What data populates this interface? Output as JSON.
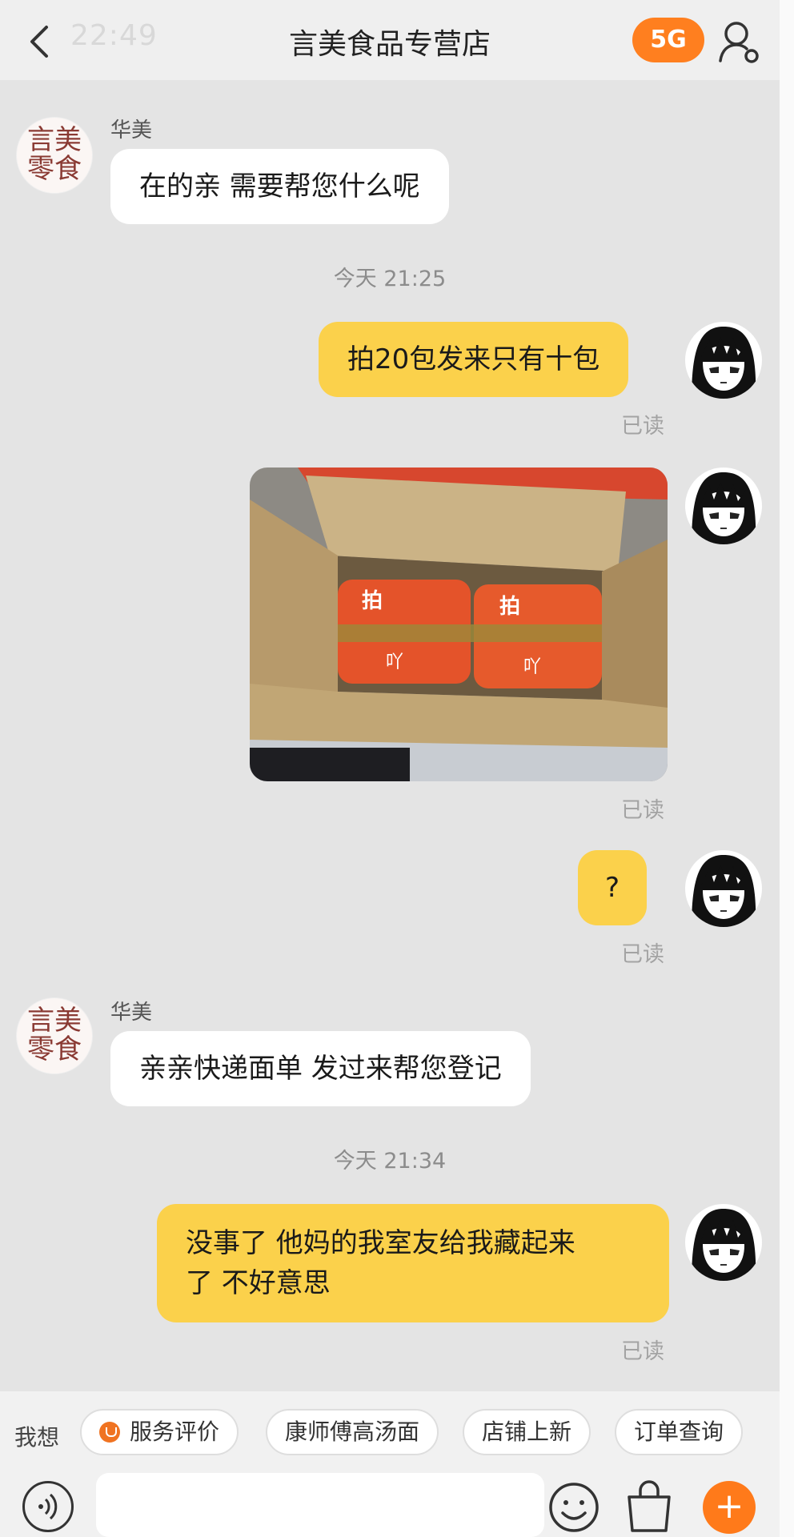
{
  "status_bar": {
    "time": "22:49",
    "network": "5G"
  },
  "header": {
    "title": "言美食品专营店"
  },
  "shop": {
    "avatar_text_line1": "言美",
    "avatar_text_line2": "零食"
  },
  "messages": [
    {
      "sender": "华美",
      "text": "在的亲 需要帮您什么呢"
    },
    {
      "timestamp": "今天 21:25"
    },
    {
      "text": "拍20包发来只有十包",
      "status": "已读"
    },
    {
      "type": "image",
      "status": "已读"
    },
    {
      "text": "?",
      "status": "已读"
    },
    {
      "sender": "华美",
      "text": "亲亲快递面单 发过来帮您登记"
    },
    {
      "timestamp": "今天 21:34"
    },
    {
      "text_line1": "没事了 他妈的我室友给我藏起来",
      "text_line2": "了 不好意思",
      "status": "已读"
    }
  ],
  "quick_replies": {
    "label": "我想",
    "items": [
      {
        "label": "服务评价",
        "icon": "service-icon"
      },
      {
        "label": "康师傅高汤面"
      },
      {
        "label": "店铺上新"
      },
      {
        "label": "订单查询"
      }
    ]
  },
  "input": {
    "placeholder": ""
  },
  "colors": {
    "accent": "#ff7a1a",
    "user_bubble": "#fbd14b",
    "background": "#e4e4e4"
  }
}
